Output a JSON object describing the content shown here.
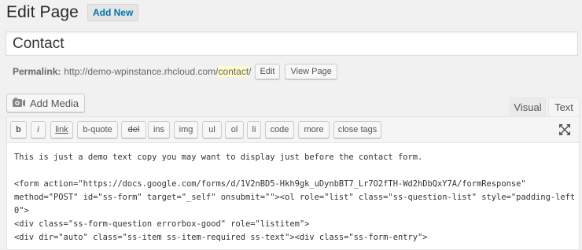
{
  "header": {
    "title": "Edit Page",
    "add_new_label": "Add New"
  },
  "post_title": {
    "value": "Contact"
  },
  "permalink": {
    "label": "Permalink:",
    "base_url": "http://demo-wpinstance.rhcloud.com/",
    "slug": "contact",
    "trailing": "/",
    "edit_label": "Edit",
    "view_label": "View Page"
  },
  "media": {
    "add_media_label": "Add Media",
    "icon": "media-camera-icon"
  },
  "editor_tabs": {
    "visual_label": "Visual",
    "text_label": "Text",
    "active": "Text"
  },
  "quicktags": [
    {
      "key": "b",
      "label": "b"
    },
    {
      "key": "i",
      "label": "i"
    },
    {
      "key": "link",
      "label": "link"
    },
    {
      "key": "b-quote",
      "label": "b-quote"
    },
    {
      "key": "del",
      "label": "del"
    },
    {
      "key": "ins",
      "label": "ins"
    },
    {
      "key": "img",
      "label": "img"
    },
    {
      "key": "ul",
      "label": "ul"
    },
    {
      "key": "ol",
      "label": "ol"
    },
    {
      "key": "li",
      "label": "li"
    },
    {
      "key": "code",
      "label": "code"
    },
    {
      "key": "more",
      "label": "more"
    },
    {
      "key": "close-tags",
      "label": "close tags"
    }
  ],
  "toolbar": {
    "fullscreen_icon": "expand-icon"
  },
  "content_lines": [
    "This is just a demo text copy you may want to display just before the contact form.",
    "",
    "<form action=\"https://docs.google.com/forms/d/1V2nBD5-Hkh9gk_uDynbBT7_Lr7O2fTH-Wd2hDbQxY7A/formResponse\"",
    "method=\"POST\" id=\"ss-form\" target=\"_self\" onsubmit=\"\"><ol role=\"list\" class=\"ss-question-list\" style=\"padding-left:",
    "0\">",
    "<div class=\"ss-form-question errorbox-good\" role=\"listitem\">",
    "<div dir=\"auto\" class=\"ss-item ss-item-required ss-text\"><div class=\"ss-form-entry\">"
  ],
  "colors": {
    "link_blue": "#0073aa",
    "slug_highlight": "#fffbcc"
  }
}
